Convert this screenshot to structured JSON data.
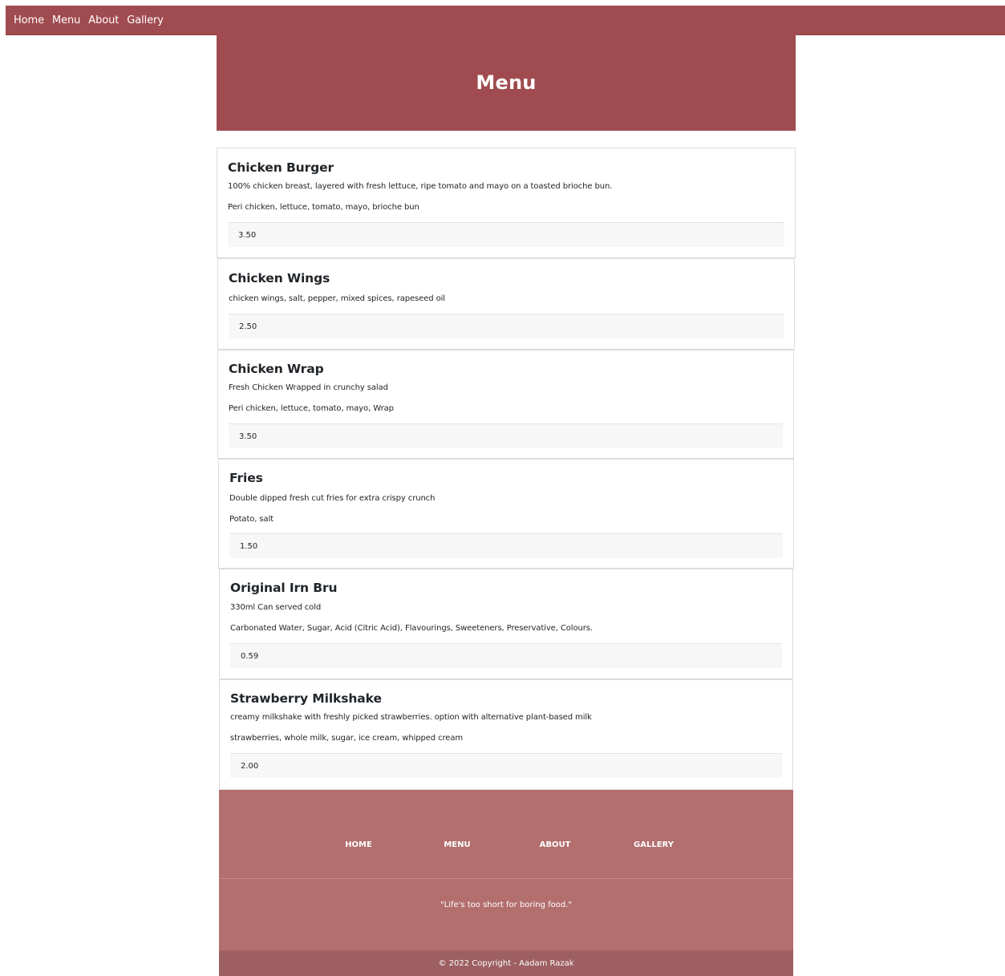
{
  "nav": {
    "items": [
      {
        "label": "Home"
      },
      {
        "label": "Menu"
      },
      {
        "label": "About"
      },
      {
        "label": "Gallery"
      }
    ]
  },
  "page": {
    "title": "Menu"
  },
  "menu_items": [
    {
      "name": "Chicken Burger",
      "description": "100% chicken breast, layered with fresh lettuce, ripe tomato and mayo on a toasted brioche bun.",
      "ingredients": "Peri chicken, lettuce, tomato, mayo, brioche bun",
      "price": "3.50"
    },
    {
      "name": "Chicken Wings",
      "description": "",
      "ingredients": "chicken wings, salt, pepper, mixed spices, rapeseed oil",
      "price": "2.50"
    },
    {
      "name": "Chicken Wrap",
      "description": "Fresh Chicken Wrapped in crunchy salad",
      "ingredients": "Peri chicken, lettuce, tomato, mayo, Wrap",
      "price": "3.50"
    },
    {
      "name": "Fries",
      "description": "Double dipped fresh cut fries for extra crispy crunch",
      "ingredients": "Potato, salt",
      "price": "1.50"
    },
    {
      "name": "Original Irn Bru",
      "description": "330ml Can served cold",
      "ingredients": "Carbonated Water, Sugar, Acid (Citric Acid), Flavourings, Sweeteners, Preservative, Colours.",
      "price": "0.59"
    },
    {
      "name": "Strawberry Milkshake",
      "description": "creamy milkshake with freshly picked strawberries. option with alternative plant-based milk",
      "ingredients": "strawberries, whole milk, sugar, ice cream, whipped cream",
      "price": "2.00"
    }
  ],
  "footer": {
    "links": [
      {
        "label": "HOME"
      },
      {
        "label": "MENU"
      },
      {
        "label": "ABOUT"
      },
      {
        "label": "GALLERY"
      }
    ],
    "quote": "\"Life's too short for boring food.\"",
    "copyright": "© 2022 Copyright - Aadam Razak"
  },
  "colors": {
    "brand": "#a04b4f",
    "footer": "#b36e6e",
    "footer_bottom": "#9d5f60"
  }
}
